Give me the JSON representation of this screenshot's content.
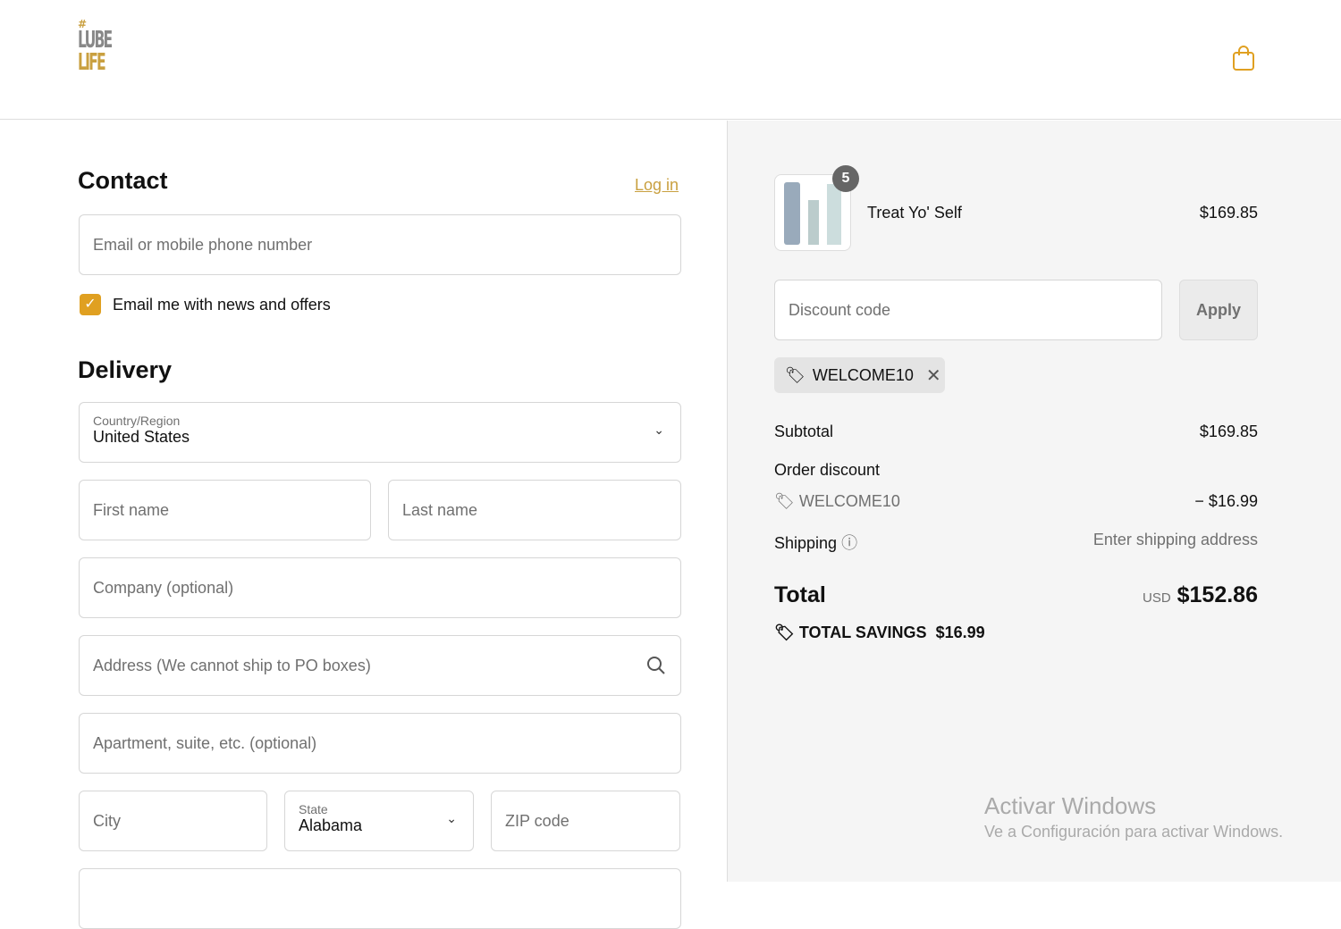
{
  "header": {
    "logo_text": "#LUBE LIFE",
    "cart_icon": "shopping-bag-icon"
  },
  "contact": {
    "title": "Contact",
    "login": "Log in",
    "email_placeholder": "Email or mobile phone number",
    "newsletter_label": "Email me with news and offers",
    "newsletter_checked": true
  },
  "delivery": {
    "title": "Delivery",
    "country_label": "Country/Region",
    "country_value": "United States",
    "first_name": "First name",
    "last_name": "Last name",
    "company": "Company (optional)",
    "address": "Address (We cannot ship to PO boxes)",
    "apartment": "Apartment, suite, etc. (optional)",
    "city": "City",
    "state_label": "State",
    "state_value": "Alabama",
    "zip": "ZIP code"
  },
  "summary": {
    "item": {
      "name": "Treat Yo' Self",
      "price": "$169.85",
      "quantity": "5"
    },
    "discount_placeholder": "Discount code",
    "apply": "Apply",
    "applied_code": "WELCOME10",
    "subtotal_label": "Subtotal",
    "subtotal": "$169.85",
    "order_discount_label": "Order discount",
    "discount_code": "WELCOME10",
    "discount_amount": "− $16.99",
    "shipping_label": "Shipping",
    "shipping_value": "Enter shipping address",
    "total_label": "Total",
    "currency": "USD",
    "total": "$152.86",
    "savings_label": "TOTAL SAVINGS",
    "savings": "$16.99"
  },
  "watermark": {
    "line1": "Activar Windows",
    "line2": "Ve a Configuración para activar Windows."
  }
}
